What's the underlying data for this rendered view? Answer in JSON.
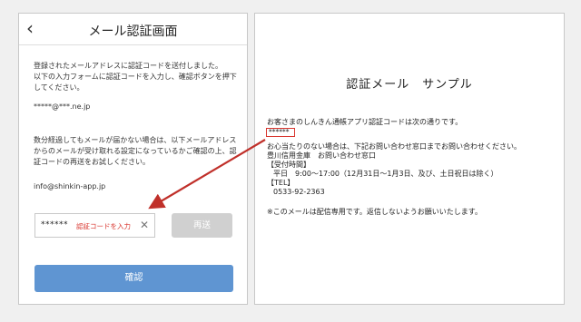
{
  "phone": {
    "title": "メール認証画面",
    "back_icon": "chevron-left-icon",
    "intro_text": "登録されたメールアドレスに認証コードを送付しました。\n以下の入力フォームに認証コードを入力し、確認ボタンを押下してください。",
    "email": "*****@***.ne.jp",
    "notice_text": "数分経過してもメールが届かない場合は、以下メールアドレスからのメールが受け取れる設定になっているかご確認の上、認証コードの再送をお試しください。",
    "support_email": "info@shinkin-app.jp",
    "code_value": "******",
    "code_placeholder": "認証コードを入力",
    "clear_icon": "close-icon",
    "resend_label": "再送",
    "confirm_label": "確認",
    "confirm_color": "#5f95d2",
    "resend_color": "#d0d0d0"
  },
  "sample": {
    "title": "認証メール　サンプル",
    "greeting": "お客さまのしんきん通帳アプリ認証コードは次の通りです。",
    "code": "******",
    "inquiry": "お心当たりのない場合は、下記お問い合わせ窓口までお問い合わせください。",
    "bank": "豊川信用金庫　お問い合わせ窓口",
    "hours_label": "【受付時間】",
    "hours": "平日　9:00～17:00（12月31日～1月3日、及び、土日祝日は除く）",
    "tel_label": "【TEL】",
    "tel": "0533-92-2363",
    "footer": "※このメールは配信専用です。返信しないようお願いいたします。"
  },
  "arrow": {
    "color": "#c0302a",
    "from": "sample-code",
    "to": "code-field"
  }
}
